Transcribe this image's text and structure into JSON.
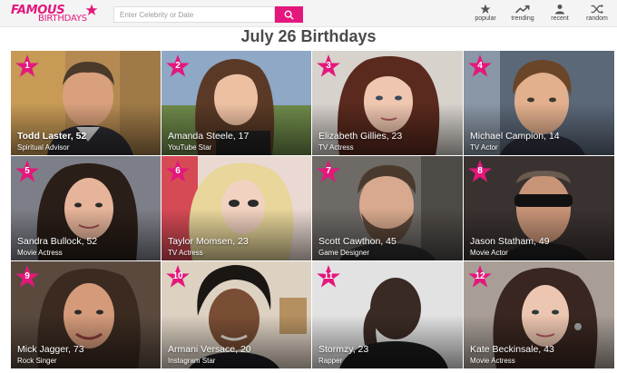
{
  "header": {
    "logo_top": "FAMOUS",
    "logo_bottom": "BIRTHDAYS",
    "search_placeholder": "Enter Celebrity or Date",
    "nav": [
      {
        "label": "popular",
        "icon": "star-icon"
      },
      {
        "label": "trending",
        "icon": "trending-icon"
      },
      {
        "label": "recent",
        "icon": "person-icon"
      },
      {
        "label": "random",
        "icon": "shuffle-icon"
      }
    ]
  },
  "page": {
    "title": "July 26 Birthdays"
  },
  "colors": {
    "brand": "#e4177c",
    "topbar": "#f4f4f4"
  },
  "celebrities": [
    {
      "rank": "1",
      "name": "Todd Laster, 52",
      "job": "Spiritual Advisor"
    },
    {
      "rank": "2",
      "name": "Amanda Steele, 17",
      "job": "YouTube Star"
    },
    {
      "rank": "3",
      "name": "Elizabeth Gillies, 23",
      "job": "TV Actress"
    },
    {
      "rank": "4",
      "name": "Michael Campion, 14",
      "job": "TV Actor"
    },
    {
      "rank": "5",
      "name": "Sandra Bullock, 52",
      "job": "Movie Actress"
    },
    {
      "rank": "6",
      "name": "Taylor Momsen, 23",
      "job": "TV Actress"
    },
    {
      "rank": "7",
      "name": "Scott Cawthon, 45",
      "job": "Game Designer"
    },
    {
      "rank": "8",
      "name": "Jason Statham, 49",
      "job": "Movie Actor"
    },
    {
      "rank": "9",
      "name": "Mick Jagger, 73",
      "job": "Rock Singer"
    },
    {
      "rank": "10",
      "name": "Armani Versace, 20",
      "job": "Instagram Star"
    },
    {
      "rank": "11",
      "name": "Stormzy, 23",
      "job": "Rapper"
    },
    {
      "rank": "12",
      "name": "Kate Beckinsale, 43",
      "job": "Movie Actress"
    }
  ]
}
